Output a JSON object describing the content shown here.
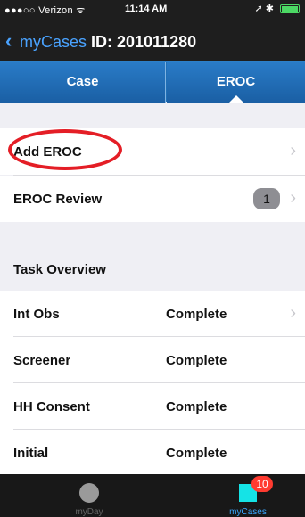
{
  "status_bar": {
    "carrier": "●●●○○ Verizon ᯤ",
    "time": "11:14 AM",
    "right_icons": "➚ ✱"
  },
  "nav": {
    "back_label": "myCases",
    "case_id": "ID: 201011280"
  },
  "tabs": [
    {
      "label": "Case",
      "selected": false
    },
    {
      "label": "EROC",
      "selected": true
    }
  ],
  "eroc_list": [
    {
      "label": "Add EROC",
      "chevron": true
    },
    {
      "label": "EROC Review",
      "badge": "1",
      "chevron": true
    }
  ],
  "task_overview": {
    "header": "Task Overview",
    "rows": [
      {
        "label": "Int Obs",
        "status": "Complete",
        "chevron": true
      },
      {
        "label": "Screener",
        "status": "Complete"
      },
      {
        "label": "HH Consent",
        "status": "Complete"
      },
      {
        "label": "Initial",
        "status": "Complete"
      }
    ]
  },
  "tab_bar": {
    "items": [
      {
        "label": "myDay",
        "icon": "circle-icon"
      },
      {
        "label": "myCases",
        "icon": "square-icon",
        "badge": "10",
        "active": true
      }
    ]
  },
  "colors": {
    "accent": "#4aa3ff",
    "tab_blue": "#1f6fb6",
    "annotation": "#e41e26",
    "badge_red": "#ff3b30"
  }
}
